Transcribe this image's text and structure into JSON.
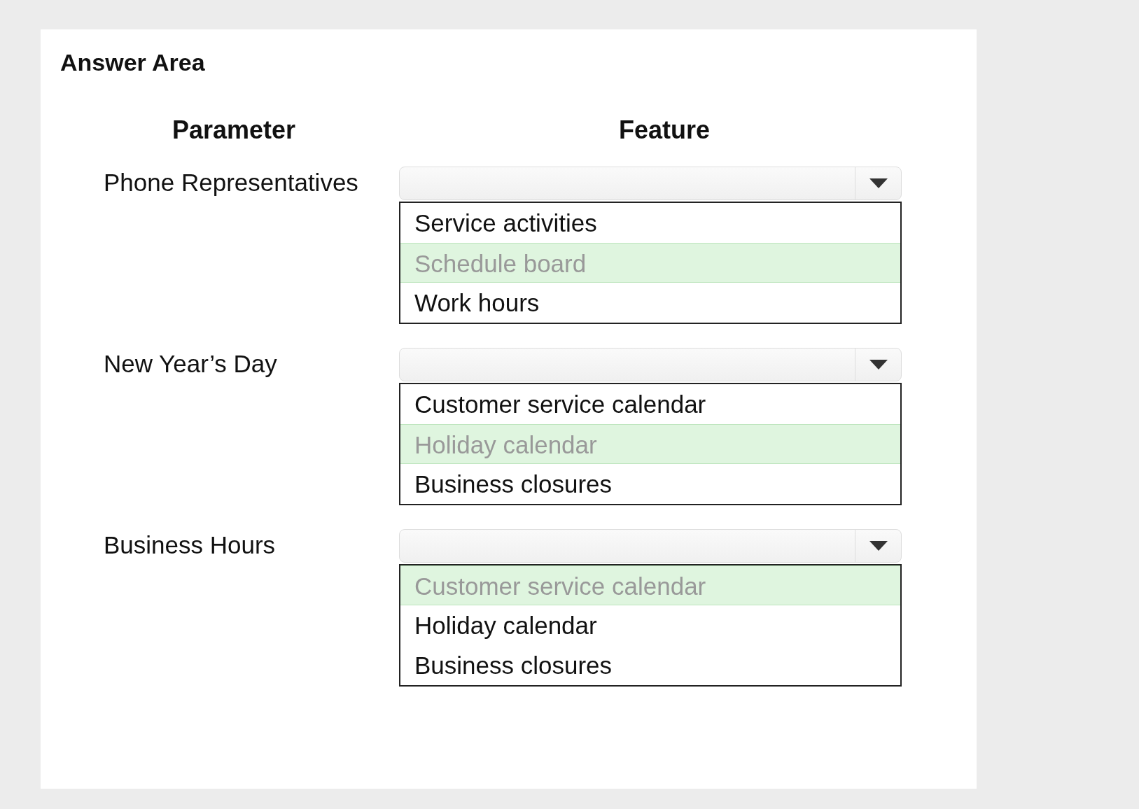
{
  "title": "Answer Area",
  "columns": [
    "Parameter",
    "Feature"
  ],
  "rows": [
    {
      "parameter": "Phone Representatives",
      "options": [
        {
          "label": "Service activities",
          "selected": false
        },
        {
          "label": "Schedule board",
          "selected": true
        },
        {
          "label": "Work hours",
          "selected": false
        }
      ]
    },
    {
      "parameter": "New Year’s Day",
      "options": [
        {
          "label": "Customer service calendar",
          "selected": false
        },
        {
          "label": "Holiday calendar",
          "selected": true
        },
        {
          "label": "Business closures",
          "selected": false
        }
      ]
    },
    {
      "parameter": "Business Hours",
      "options": [
        {
          "label": "Customer service calendar",
          "selected": true
        },
        {
          "label": "Holiday calendar",
          "selected": false
        },
        {
          "label": "Business closures",
          "selected": false
        }
      ]
    }
  ]
}
